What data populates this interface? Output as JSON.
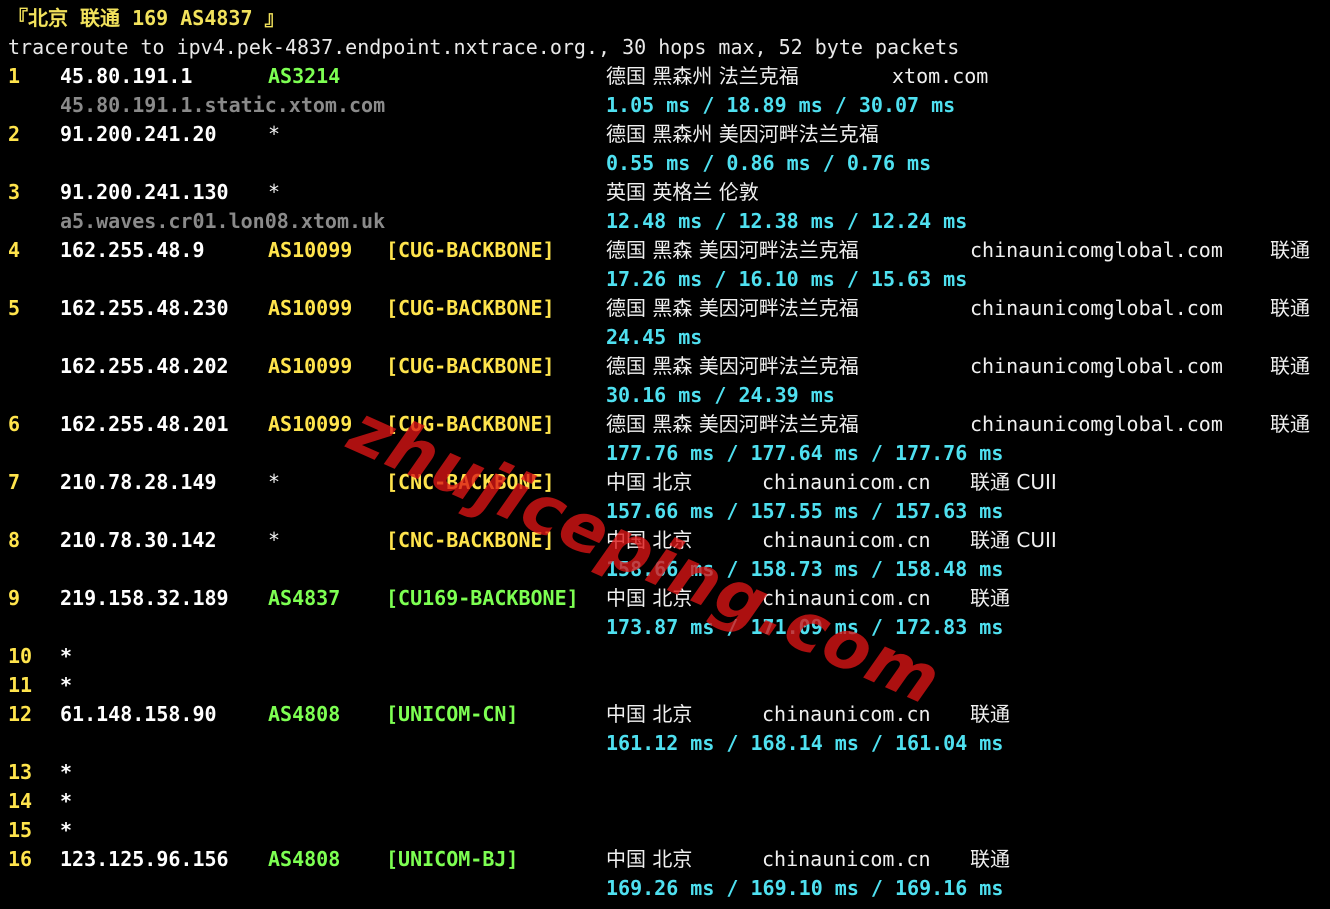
{
  "header": {
    "title": "『北京 联通 169 AS4837 』",
    "command": "traceroute to ipv4.pek-4837.endpoint.nxtrace.org., 30 hops max, 52 byte packets"
  },
  "colors": {
    "background": "#000000",
    "hop_number": "#ffe44c",
    "asn_green": "#7dff52",
    "rtt": "#4fe0f0",
    "rdns": "#8a8a8a",
    "watermark": "#dc1414"
  },
  "watermark": "zhujiceping.com",
  "hops": [
    {
      "hop": "1",
      "ip": "45.80.191.1",
      "asn": "AS3214",
      "tag": "",
      "geo": "德国 黑森州 法兰克福",
      "domain": "xtom.com",
      "isp": "",
      "rdns": "45.80.191.1.static.xtom.com",
      "rtt": "1.05 ms / 18.89 ms / 30.07 ms"
    },
    {
      "hop": "2",
      "ip": "91.200.241.20",
      "asn": "*",
      "tag": "",
      "geo": "德国 黑森州 美因河畔法兰克福",
      "domain": "",
      "isp": "",
      "rdns": "",
      "rtt": "0.55 ms / 0.86 ms / 0.76 ms"
    },
    {
      "hop": "3",
      "ip": "91.200.241.130",
      "asn": "*",
      "tag": "",
      "geo": "英国 英格兰 伦敦",
      "domain": "",
      "isp": "",
      "rdns": "a5.waves.cr01.lon08.xtom.uk",
      "rtt": "12.48 ms / 12.38 ms / 12.24 ms"
    },
    {
      "hop": "4",
      "ip": "162.255.48.9",
      "asn": "AS10099",
      "tag": "[CUG-BACKBONE]",
      "geo": "德国 黑森 美因河畔法兰克福",
      "domain": "chinaunicomglobal.com",
      "isp": "联通",
      "rdns": "",
      "rtt": "17.26 ms / 16.10 ms / 15.63 ms"
    },
    {
      "hop": "5",
      "ip": "162.255.48.230",
      "asn": "AS10099",
      "tag": "[CUG-BACKBONE]",
      "geo": "德国 黑森 美因河畔法兰克福",
      "domain": "chinaunicomglobal.com",
      "isp": "联通",
      "rdns": "",
      "rtt": "24.45 ms"
    },
    {
      "hop": "",
      "ip": "162.255.48.202",
      "asn": "AS10099",
      "tag": "[CUG-BACKBONE]",
      "geo": "德国 黑森 美因河畔法兰克福",
      "domain": "chinaunicomglobal.com",
      "isp": "联通",
      "rdns": "",
      "rtt": "30.16 ms / 24.39 ms"
    },
    {
      "hop": "6",
      "ip": "162.255.48.201",
      "asn": "AS10099",
      "tag": "[CUG-BACKBONE]",
      "geo": "德国 黑森 美因河畔法兰克福",
      "domain": "chinaunicomglobal.com",
      "isp": "联通",
      "rdns": "",
      "rtt": "177.76 ms / 177.64 ms / 177.76 ms"
    },
    {
      "hop": "7",
      "ip": "210.78.28.149",
      "asn": "*",
      "tag": "[CNC-BACKBONE]",
      "geo": "中国 北京",
      "domain": "chinaunicom.cn",
      "isp": "联通 CUII",
      "rdns": "",
      "rtt": "157.66 ms / 157.55 ms / 157.63 ms"
    },
    {
      "hop": "8",
      "ip": "210.78.30.142",
      "asn": "*",
      "tag": "[CNC-BACKBONE]",
      "geo": "中国 北京",
      "domain": "chinaunicom.cn",
      "isp": "联通 CUII",
      "rdns": "",
      "rtt": "158.66 ms / 158.73 ms / 158.48 ms"
    },
    {
      "hop": "9",
      "ip": "219.158.32.189",
      "asn": "AS4837",
      "tag": "[CU169-BACKBONE]",
      "geo": "中国 北京",
      "domain": "chinaunicom.cn",
      "isp": "联通",
      "rdns": "",
      "rtt": "173.87 ms / 171.09 ms / 172.83 ms"
    },
    {
      "hop": "10",
      "ip": "*"
    },
    {
      "hop": "11",
      "ip": "*"
    },
    {
      "hop": "12",
      "ip": "61.148.158.90",
      "asn": "AS4808",
      "tag": "[UNICOM-CN]",
      "geo": "中国 北京",
      "domain": "chinaunicom.cn",
      "isp": "联通",
      "rdns": "",
      "rtt": "161.12 ms / 168.14 ms / 161.04 ms"
    },
    {
      "hop": "13",
      "ip": "*"
    },
    {
      "hop": "14",
      "ip": "*"
    },
    {
      "hop": "15",
      "ip": "*"
    },
    {
      "hop": "16",
      "ip": "123.125.96.156",
      "asn": "AS4808",
      "tag": "[UNICOM-BJ]",
      "geo": "中国 北京",
      "domain": "chinaunicom.cn",
      "isp": "联通",
      "rdns": "",
      "rtt": "169.26 ms / 169.10 ms / 169.16 ms"
    }
  ]
}
